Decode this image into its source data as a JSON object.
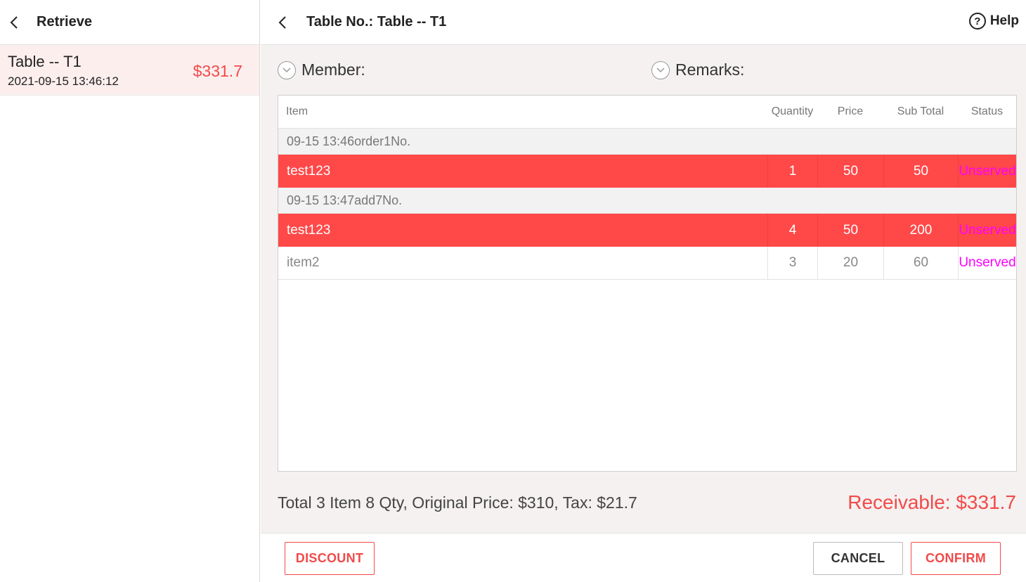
{
  "left_panel": {
    "title": "Retrieve",
    "orders": [
      {
        "name": "Table -- T1",
        "time": "2021-09-15 13:46:12",
        "amount": "$331.7"
      }
    ]
  },
  "header": {
    "title": "Table No.: Table -- T1",
    "help_label": "Help"
  },
  "meta": {
    "member_label": "Member:",
    "remarks_label": "Remarks:"
  },
  "table": {
    "columns": [
      "Item",
      "Quantity",
      "Price",
      "Sub Total",
      "Status"
    ],
    "groups": [
      {
        "label": "09-15 13:46order1No.",
        "rows": [
          {
            "item": "test123",
            "qty": "1",
            "price": "50",
            "subtotal": "50",
            "status": "Unserved",
            "selected": true
          }
        ]
      },
      {
        "label": "09-15 13:47add7No.",
        "rows": [
          {
            "item": "test123",
            "qty": "4",
            "price": "50",
            "subtotal": "200",
            "status": "Unserved",
            "selected": true
          },
          {
            "item": "item2",
            "qty": "3",
            "price": "20",
            "subtotal": "60",
            "status": "Unserved",
            "selected": false
          }
        ]
      }
    ]
  },
  "summary": {
    "text": "Total 3 Item 8 Qty, Original Price: $310, Tax: $21.7",
    "receivable": "Receivable: $331.7"
  },
  "footer": {
    "discount_label": "DISCOUNT",
    "cancel_label": "CANCEL",
    "confirm_label": "CONFIRM"
  },
  "colors": {
    "accent": "#f24a4a",
    "selected_row": "#ff4848",
    "status_unserved": "#ff00ff",
    "selected_order_bg": "#fdeeee"
  }
}
